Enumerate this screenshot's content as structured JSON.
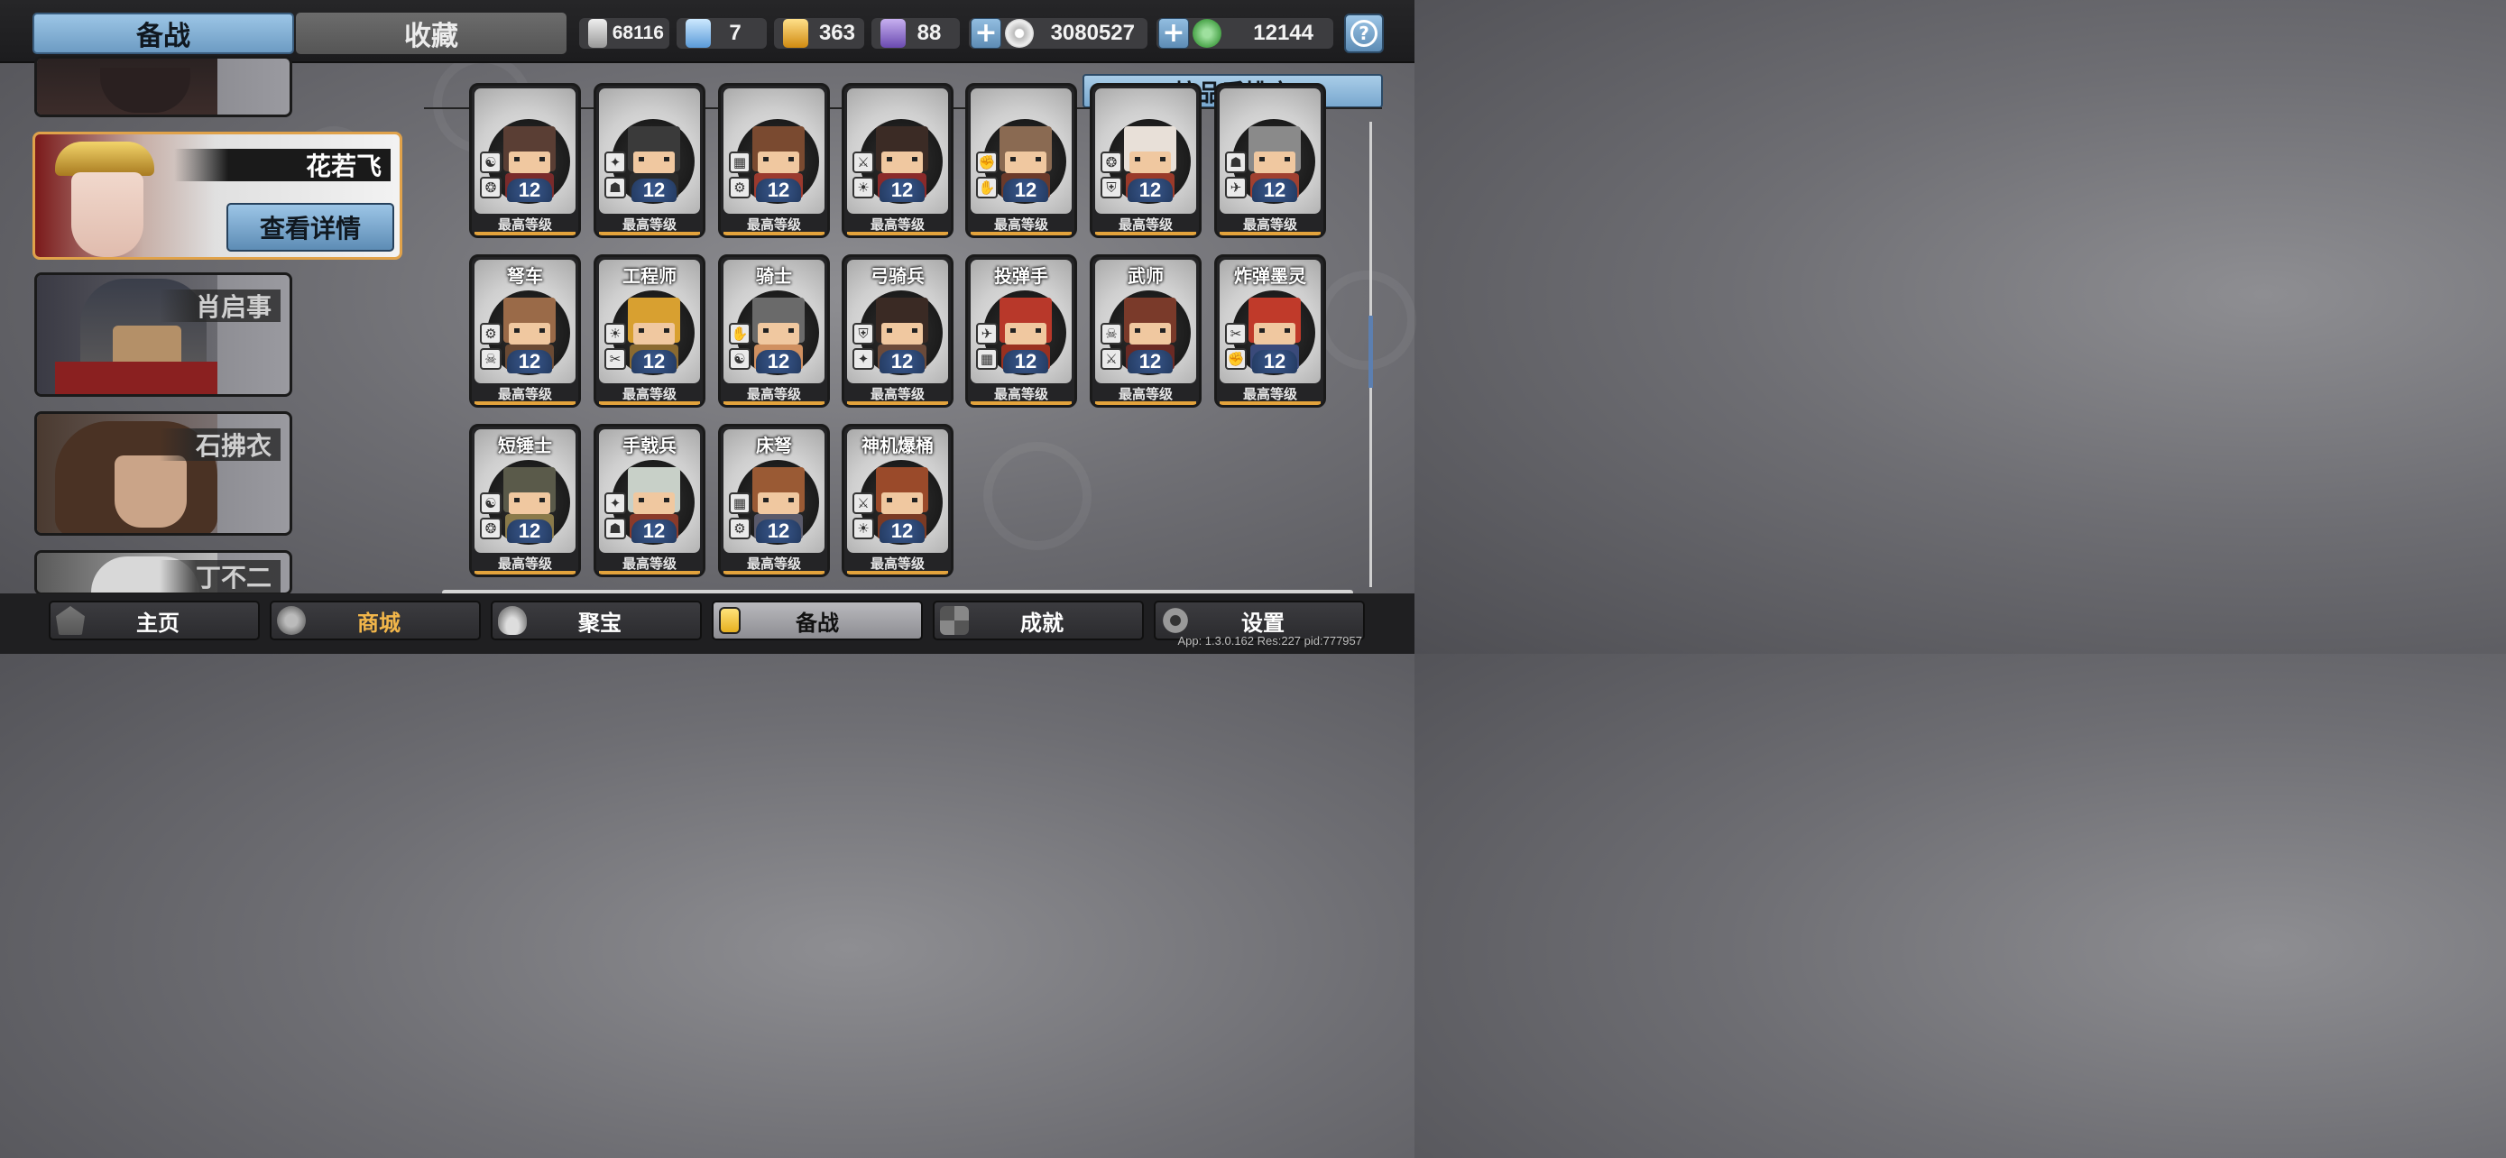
{
  "top_tabs": {
    "active": "备战",
    "inactive": "收藏"
  },
  "resources": [
    {
      "name": "silver-shield",
      "value": "68116",
      "color": "#c9c9c9"
    },
    {
      "name": "crystal",
      "value": "7",
      "color": "#8fc3f0"
    },
    {
      "name": "gold-medal",
      "value": "363",
      "color": "#f0b83a"
    },
    {
      "name": "purple-token",
      "value": "88",
      "color": "#8f6fd0"
    }
  ],
  "currencies": [
    {
      "name": "silver-coin",
      "value": "3080527",
      "color": "#d8d8d8"
    },
    {
      "name": "jade-coin",
      "value": "12144",
      "color": "#5cb85c"
    }
  ],
  "help_label": "?",
  "heroes": [
    {
      "name": ""
    },
    {
      "name": "花若飞",
      "selected": true,
      "detail_button": "查看详情"
    },
    {
      "name": "肖启事"
    },
    {
      "name": "石拂衣"
    },
    {
      "name": "丁不二"
    }
  ],
  "sort_button": "按品质排序",
  "units": [
    {
      "name": "",
      "level": "12",
      "max_label": "最高等级",
      "head": "#5a3e34",
      "body": "#7a2b2b"
    },
    {
      "name": "",
      "level": "12",
      "max_label": "最高等级",
      "head": "#3a3a3a",
      "body": "#2b2b2b"
    },
    {
      "name": "",
      "level": "12",
      "max_label": "最高等级",
      "head": "#7a4a30",
      "body": "#9b3a2e"
    },
    {
      "name": "",
      "level": "12",
      "max_label": "最高等级",
      "head": "#3b2b25",
      "body": "#8a2a2a"
    },
    {
      "name": "",
      "level": "12",
      "max_label": "最高等级",
      "head": "#8a6a52",
      "body": "#6b3a2a"
    },
    {
      "name": "",
      "level": "12",
      "max_label": "最高等级",
      "head": "#e8e0d8",
      "body": "#9a3a2a"
    },
    {
      "name": "",
      "level": "12",
      "max_label": "最高等级",
      "head": "#8a8a8a",
      "body": "#a04030"
    },
    {
      "name": "弩车",
      "level": "12",
      "max_label": "最高等级",
      "head": "#9a6a48",
      "body": "#6a4a34"
    },
    {
      "name": "工程师",
      "level": "12",
      "max_label": "最高等级",
      "head": "#d8a030",
      "body": "#8a6a30"
    },
    {
      "name": "骑士",
      "level": "12",
      "max_label": "最高等级",
      "head": "#6a6a6a",
      "body": "#d09060"
    },
    {
      "name": "弓骑兵",
      "level": "12",
      "max_label": "最高等级",
      "head": "#3a2a24",
      "body": "#6a4a3a"
    },
    {
      "name": "投弹手",
      "level": "12",
      "max_label": "最高等级",
      "head": "#b8382a",
      "body": "#9a3020"
    },
    {
      "name": "武师",
      "level": "12",
      "max_label": "最高等级",
      "head": "#7a3a2a",
      "body": "#6a2a24"
    },
    {
      "name": "炸弹墨灵",
      "level": "12",
      "max_label": "最高等级",
      "head": "#c03a2a",
      "body": "#3a4a7a"
    },
    {
      "name": "短锤士",
      "level": "12",
      "max_label": "最高等级",
      "head": "#5a5a4a",
      "body": "#8a7a4a"
    },
    {
      "name": "手戟兵",
      "level": "12",
      "max_label": "最高等级",
      "head": "#c8d0c8",
      "body": "#8a3a2a"
    },
    {
      "name": "床弩",
      "level": "12",
      "max_label": "最高等级",
      "head": "#9a5a34",
      "body": "#5a5a6a"
    },
    {
      "name": "神机爆桶",
      "level": "12",
      "max_label": "最高等级",
      "head": "#9a4a2a",
      "body": "#7a3a24"
    }
  ],
  "nav": [
    {
      "label": "主页",
      "icon": "home-icon"
    },
    {
      "label": "商城",
      "icon": "shop-icon"
    },
    {
      "label": "聚宝",
      "icon": "treasure-icon"
    },
    {
      "label": "备战",
      "icon": "cards-icon"
    },
    {
      "label": "成就",
      "icon": "achievement-icon"
    },
    {
      "label": "设置",
      "icon": "gear-icon"
    }
  ],
  "version": "App: 1.3.0.162 Res:227 pid:777957"
}
